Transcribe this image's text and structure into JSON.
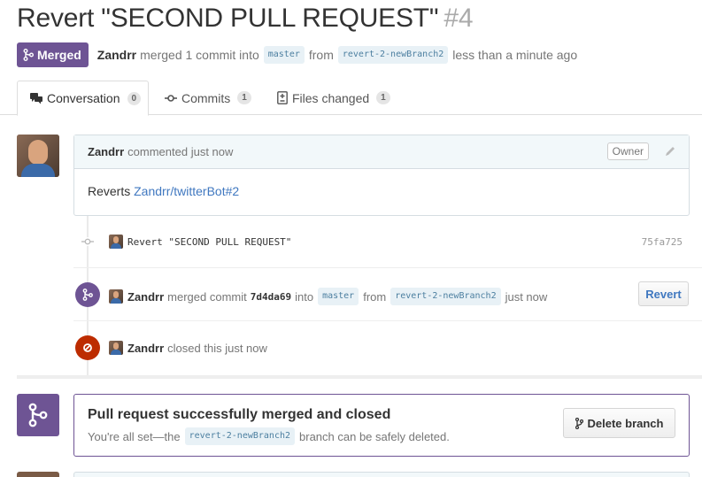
{
  "header": {
    "title": "Revert \"SECOND PULL REQUEST\"",
    "number": "#4"
  },
  "status": {
    "badge": "Merged",
    "user": "Zandrr",
    "text1": "merged 1 commit into",
    "base_branch": "master",
    "text2": "from",
    "head_branch": "revert-2-newBranch2",
    "time": "less than a minute ago"
  },
  "tabs": [
    {
      "label": "Conversation",
      "count": "0"
    },
    {
      "label": "Commits",
      "count": "1"
    },
    {
      "label": "Files changed",
      "count": "1"
    }
  ],
  "comment": {
    "user": "Zandrr",
    "action": "commented just now",
    "role": "Owner",
    "body_prefix": "Reverts",
    "body_link": "Zandrr/twitterBot#2"
  },
  "commit_event": {
    "message": "Revert \"SECOND PULL REQUEST\"",
    "sha": "75fa725"
  },
  "merge_event": {
    "user": "Zandrr",
    "text1": "merged commit",
    "sha": "7d4da69",
    "text2": "into",
    "base_branch": "master",
    "text3": "from",
    "head_branch": "revert-2-newBranch2",
    "time": "just now",
    "button": "Revert"
  },
  "close_event": {
    "user": "Zandrr",
    "text": "closed this just now"
  },
  "merged_box": {
    "heading": "Pull request successfully merged and closed",
    "text1": "You're all set—the",
    "branch": "revert-2-newBranch2",
    "text2": "branch can be safely deleted.",
    "button": "Delete branch"
  },
  "colors": {
    "merged": "#6e5494",
    "closed": "#bd2c00",
    "link": "#4078c0"
  }
}
